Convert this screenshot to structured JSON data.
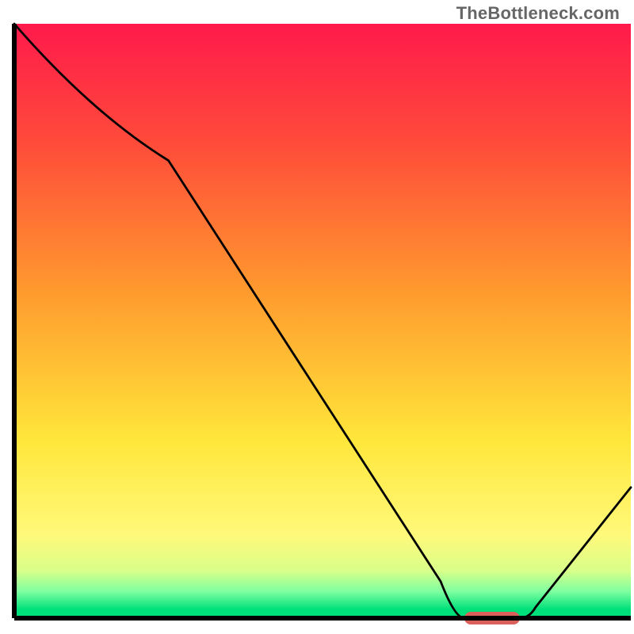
{
  "watermark": "TheBottleneck.com",
  "chart_data": {
    "type": "line",
    "title": "",
    "xlabel": "",
    "ylabel": "",
    "xlim": [
      0,
      100
    ],
    "ylim": [
      0,
      100
    ],
    "x": [
      0,
      25,
      73,
      82,
      100
    ],
    "values": [
      100,
      77,
      0,
      0,
      22
    ],
    "marker": {
      "x_start": 73,
      "x_end": 82,
      "y": 0,
      "color": "#d9605b"
    },
    "gradient_stops": [
      {
        "offset": 0.0,
        "color": "#ff1a4b"
      },
      {
        "offset": 0.2,
        "color": "#ff4b3a"
      },
      {
        "offset": 0.45,
        "color": "#ff9a2e"
      },
      {
        "offset": 0.7,
        "color": "#ffe63a"
      },
      {
        "offset": 0.86,
        "color": "#fff97a"
      },
      {
        "offset": 0.92,
        "color": "#d9ff8a"
      },
      {
        "offset": 0.955,
        "color": "#7fffa0"
      },
      {
        "offset": 0.985,
        "color": "#00e07a"
      }
    ],
    "axis_color": "#000000",
    "line_color": "#000000",
    "grid": false,
    "legend": null
  }
}
